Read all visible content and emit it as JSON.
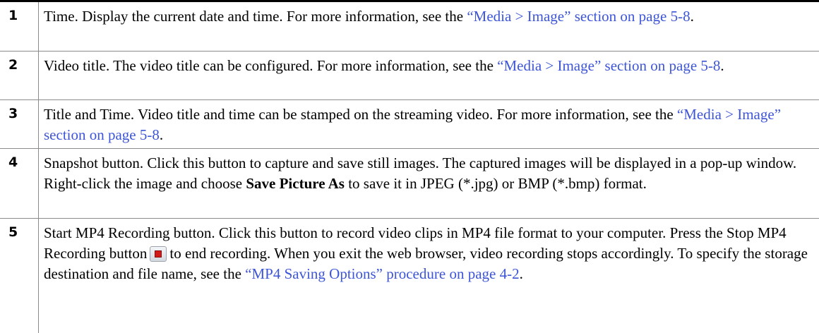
{
  "rows": [
    {
      "num": "1",
      "text_a": "Time. Display the current date and time. For more information, see the ",
      "link_a": "“Media > Image” section on page 5-8",
      "text_b": "."
    },
    {
      "num": "2",
      "text_a": "Video title. The video title can be configured. For more information, see the ",
      "link_a": "“Media > Image” section on page 5-8",
      "text_b": "."
    },
    {
      "num": "3",
      "text_a": "Title and Time. Video title and time can be stamped on the streaming video. For more information, see the ",
      "link_a": "“Media > Image” section on page 5-8",
      "text_b": "."
    },
    {
      "num": "4",
      "text_a": "Snapshot button. Click this button to capture and save still images. The captured images will be displayed in a pop-up window. Right-click the image and choose ",
      "bold_a": "Save Picture As",
      "text_b": " to save it in JPEG (*.jpg) or BMP (*.bmp) format."
    },
    {
      "num": "5",
      "text_a": "Start MP4 Recording button. Click this button to record video clips in MP4 file format to your computer. Press the Stop MP4 Recording button",
      "icon": "stop-recording-icon",
      "text_b": "to end recording. When you exit the web browser, video recording stops accordingly. To specify the storage destination and file name, see the ",
      "link_a": "“MP4 Saving Options” procedure on page 4-2",
      "text_c": "."
    }
  ]
}
